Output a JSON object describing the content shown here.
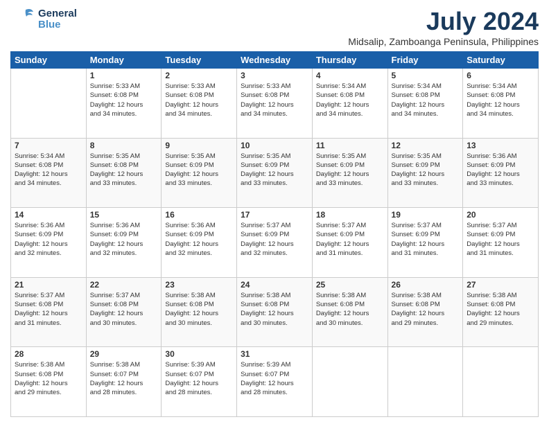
{
  "header": {
    "logo_general": "General",
    "logo_blue": "Blue",
    "month_year": "July 2024",
    "location": "Midsalip, Zamboanga Peninsula, Philippines"
  },
  "days_of_week": [
    "Sunday",
    "Monday",
    "Tuesday",
    "Wednesday",
    "Thursday",
    "Friday",
    "Saturday"
  ],
  "weeks": [
    [
      {
        "day": "",
        "info": ""
      },
      {
        "day": "1",
        "info": "Sunrise: 5:33 AM\nSunset: 6:08 PM\nDaylight: 12 hours\nand 34 minutes."
      },
      {
        "day": "2",
        "info": "Sunrise: 5:33 AM\nSunset: 6:08 PM\nDaylight: 12 hours\nand 34 minutes."
      },
      {
        "day": "3",
        "info": "Sunrise: 5:33 AM\nSunset: 6:08 PM\nDaylight: 12 hours\nand 34 minutes."
      },
      {
        "day": "4",
        "info": "Sunrise: 5:34 AM\nSunset: 6:08 PM\nDaylight: 12 hours\nand 34 minutes."
      },
      {
        "day": "5",
        "info": "Sunrise: 5:34 AM\nSunset: 6:08 PM\nDaylight: 12 hours\nand 34 minutes."
      },
      {
        "day": "6",
        "info": "Sunrise: 5:34 AM\nSunset: 6:08 PM\nDaylight: 12 hours\nand 34 minutes."
      }
    ],
    [
      {
        "day": "7",
        "info": "Sunrise: 5:34 AM\nSunset: 6:08 PM\nDaylight: 12 hours\nand 34 minutes."
      },
      {
        "day": "8",
        "info": "Sunrise: 5:35 AM\nSunset: 6:08 PM\nDaylight: 12 hours\nand 33 minutes."
      },
      {
        "day": "9",
        "info": "Sunrise: 5:35 AM\nSunset: 6:09 PM\nDaylight: 12 hours\nand 33 minutes."
      },
      {
        "day": "10",
        "info": "Sunrise: 5:35 AM\nSunset: 6:09 PM\nDaylight: 12 hours\nand 33 minutes."
      },
      {
        "day": "11",
        "info": "Sunrise: 5:35 AM\nSunset: 6:09 PM\nDaylight: 12 hours\nand 33 minutes."
      },
      {
        "day": "12",
        "info": "Sunrise: 5:35 AM\nSunset: 6:09 PM\nDaylight: 12 hours\nand 33 minutes."
      },
      {
        "day": "13",
        "info": "Sunrise: 5:36 AM\nSunset: 6:09 PM\nDaylight: 12 hours\nand 33 minutes."
      }
    ],
    [
      {
        "day": "14",
        "info": "Sunrise: 5:36 AM\nSunset: 6:09 PM\nDaylight: 12 hours\nand 32 minutes."
      },
      {
        "day": "15",
        "info": "Sunrise: 5:36 AM\nSunset: 6:09 PM\nDaylight: 12 hours\nand 32 minutes."
      },
      {
        "day": "16",
        "info": "Sunrise: 5:36 AM\nSunset: 6:09 PM\nDaylight: 12 hours\nand 32 minutes."
      },
      {
        "day": "17",
        "info": "Sunrise: 5:37 AM\nSunset: 6:09 PM\nDaylight: 12 hours\nand 32 minutes."
      },
      {
        "day": "18",
        "info": "Sunrise: 5:37 AM\nSunset: 6:09 PM\nDaylight: 12 hours\nand 31 minutes."
      },
      {
        "day": "19",
        "info": "Sunrise: 5:37 AM\nSunset: 6:09 PM\nDaylight: 12 hours\nand 31 minutes."
      },
      {
        "day": "20",
        "info": "Sunrise: 5:37 AM\nSunset: 6:09 PM\nDaylight: 12 hours\nand 31 minutes."
      }
    ],
    [
      {
        "day": "21",
        "info": "Sunrise: 5:37 AM\nSunset: 6:08 PM\nDaylight: 12 hours\nand 31 minutes."
      },
      {
        "day": "22",
        "info": "Sunrise: 5:37 AM\nSunset: 6:08 PM\nDaylight: 12 hours\nand 30 minutes."
      },
      {
        "day": "23",
        "info": "Sunrise: 5:38 AM\nSunset: 6:08 PM\nDaylight: 12 hours\nand 30 minutes."
      },
      {
        "day": "24",
        "info": "Sunrise: 5:38 AM\nSunset: 6:08 PM\nDaylight: 12 hours\nand 30 minutes."
      },
      {
        "day": "25",
        "info": "Sunrise: 5:38 AM\nSunset: 6:08 PM\nDaylight: 12 hours\nand 30 minutes."
      },
      {
        "day": "26",
        "info": "Sunrise: 5:38 AM\nSunset: 6:08 PM\nDaylight: 12 hours\nand 29 minutes."
      },
      {
        "day": "27",
        "info": "Sunrise: 5:38 AM\nSunset: 6:08 PM\nDaylight: 12 hours\nand 29 minutes."
      }
    ],
    [
      {
        "day": "28",
        "info": "Sunrise: 5:38 AM\nSunset: 6:08 PM\nDaylight: 12 hours\nand 29 minutes."
      },
      {
        "day": "29",
        "info": "Sunrise: 5:38 AM\nSunset: 6:07 PM\nDaylight: 12 hours\nand 28 minutes."
      },
      {
        "day": "30",
        "info": "Sunrise: 5:39 AM\nSunset: 6:07 PM\nDaylight: 12 hours\nand 28 minutes."
      },
      {
        "day": "31",
        "info": "Sunrise: 5:39 AM\nSunset: 6:07 PM\nDaylight: 12 hours\nand 28 minutes."
      },
      {
        "day": "",
        "info": ""
      },
      {
        "day": "",
        "info": ""
      },
      {
        "day": "",
        "info": ""
      }
    ]
  ]
}
